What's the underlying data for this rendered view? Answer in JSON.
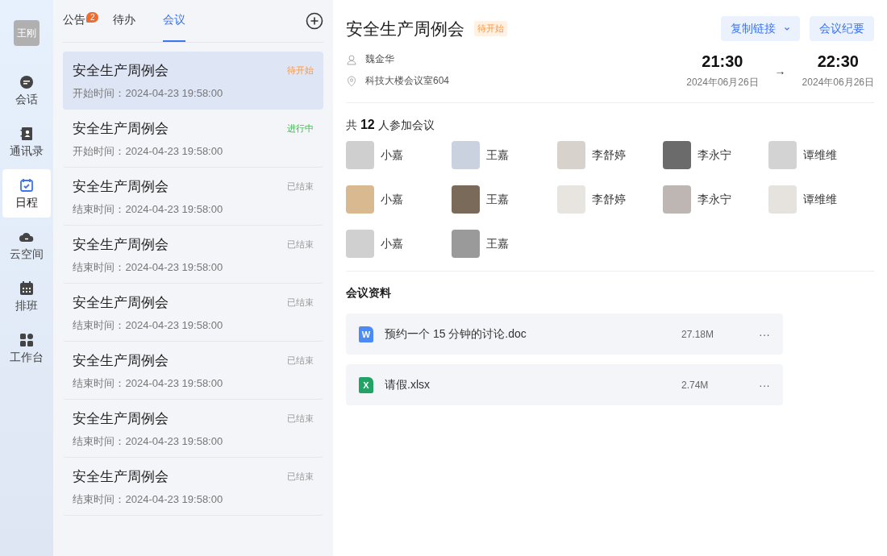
{
  "user": {
    "avatar_text": "王刚"
  },
  "nav": [
    {
      "label": "会话",
      "kind": "chat",
      "selected": false
    },
    {
      "label": "通讯录",
      "kind": "contacts",
      "selected": false
    },
    {
      "label": "日程",
      "kind": "calendar",
      "selected": true
    },
    {
      "label": "云空间",
      "kind": "cloud",
      "selected": false
    },
    {
      "label": "排班",
      "kind": "schedule",
      "selected": false
    },
    {
      "label": "工作台",
      "kind": "apps",
      "selected": false
    }
  ],
  "tabs": [
    {
      "label": "公告",
      "badge": "2",
      "selected": false
    },
    {
      "label": "待办",
      "selected": false
    },
    {
      "label": "会议",
      "selected": true
    }
  ],
  "meetings": [
    {
      "title": "安全生产周例会",
      "status": "待开始",
      "kind": "pending",
      "time": "开始时间：2024-04-23 19:58:00",
      "selected": true
    },
    {
      "title": "安全生产周例会",
      "status": "进行中",
      "kind": "ongoing",
      "time": "开始时间：2024-04-23 19:58:00",
      "selected": false
    },
    {
      "title": "安全生产周例会",
      "status": "已结束",
      "kind": "ended",
      "time": "结束时间：2024-04-23 19:58:00",
      "selected": false
    },
    {
      "title": "安全生产周例会",
      "status": "已结束",
      "kind": "ended",
      "time": "结束时间：2024-04-23 19:58:00",
      "selected": false
    },
    {
      "title": "安全生产周例会",
      "status": "已结束",
      "kind": "ended",
      "time": "结束时间：2024-04-23 19:58:00",
      "selected": false
    },
    {
      "title": "安全生产周例会",
      "status": "已结束",
      "kind": "ended",
      "time": "结束时间：2024-04-23 19:58:00",
      "selected": false
    },
    {
      "title": "安全生产周例会",
      "status": "已结束",
      "kind": "ended",
      "time": "结束时间：2024-04-23 19:58:00",
      "selected": false
    },
    {
      "title": "安全生产周例会",
      "status": "已结束",
      "kind": "ended",
      "time": "结束时间：2024-04-23 19:58:00",
      "selected": false
    }
  ],
  "detail": {
    "title": "安全生产周例会",
    "status": {
      "label": "待开始",
      "kind": "pending"
    },
    "buttons": [
      {
        "label": "复制链接",
        "dropdown": true
      },
      {
        "label": "会议纪要",
        "dropdown": false
      }
    ],
    "organizer": "魏金华",
    "location": "科技大楼会议室604",
    "start": {
      "time": "21:30",
      "date": "2024年06月26日"
    },
    "arrow": "→",
    "end": {
      "time": "22:30",
      "date": "2024年06月26日"
    },
    "attendee_summary": {
      "prefix": "共",
      "count": "12",
      "suffix": "人参加会议"
    },
    "attendees": [
      "小嘉",
      "王嘉",
      "李舒婷",
      "李永宁",
      "谭维维",
      "小嘉",
      "王嘉",
      "李舒婷",
      "李永宁",
      "谭维维",
      "小嘉",
      "王嘉"
    ],
    "files_title": "会议资料",
    "files": [
      {
        "name": "预约一个 15 分钟的讨论.doc",
        "kind": "word",
        "icon_letter": "W",
        "size": "27.18M",
        "more": "···"
      },
      {
        "name": "请假.xlsx",
        "kind": "excel",
        "icon_letter": "X",
        "size": "2.74M",
        "more": "···"
      }
    ]
  }
}
